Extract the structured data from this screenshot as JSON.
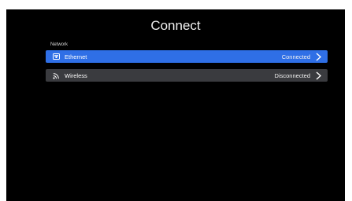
{
  "screen": {
    "title": "Connect",
    "section_label": "Network",
    "items": [
      {
        "label": "Ethernet",
        "status": "Connected",
        "icon": "ethernet-icon",
        "selected": true
      },
      {
        "label": "Wireless",
        "status": "Disconnected",
        "icon": "wifi-icon",
        "selected": false
      }
    ]
  },
  "colors": {
    "background": "#000000",
    "selected_row": "#2f6fe6",
    "row": "#3a3b3f",
    "text": "#ffffff"
  }
}
